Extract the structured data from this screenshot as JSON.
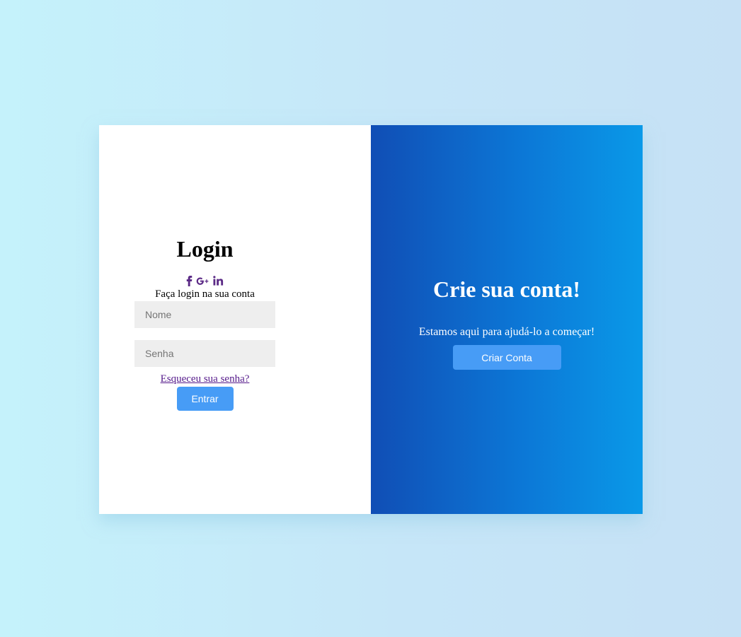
{
  "login": {
    "title": "Login",
    "social_icons": [
      "facebook-icon",
      "google-plus-icon",
      "linkedin-icon"
    ],
    "subtitle": "Faça login na sua conta",
    "name_placeholder": "Nome",
    "password_placeholder": "Senha",
    "forgot_link": "Esqueceu sua senha?",
    "submit_label": "Entrar"
  },
  "signup": {
    "title": "Crie sua conta!",
    "text": "Estamos aqui para ajudá-lo a começar!",
    "button_label": "Criar Conta"
  },
  "colors": {
    "accent_button": "#479cf6",
    "social_icon": "#5b2a86",
    "panel_gradient_start": "#104eb5",
    "panel_gradient_end": "#0a99e8",
    "input_background": "#eeeeee",
    "link": "#551a8b"
  }
}
